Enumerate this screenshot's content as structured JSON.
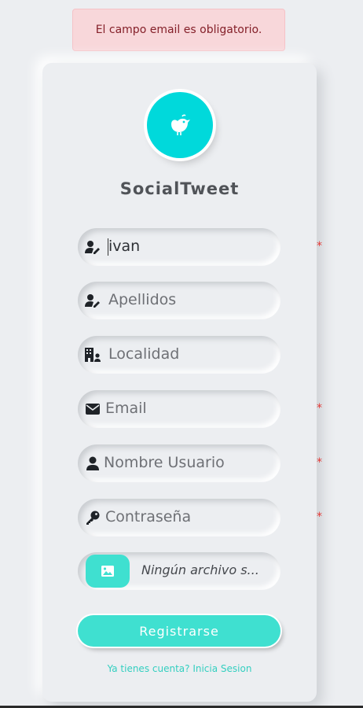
{
  "alert": {
    "message": "El campo email es obligatorio."
  },
  "brand": {
    "name": "SocialTweet",
    "accent": "#00d9db"
  },
  "form": {
    "fields": [
      {
        "name": "nombre",
        "icon": "user-edit-icon",
        "value": "ivan",
        "placeholder": "",
        "required": true
      },
      {
        "name": "apellidos",
        "icon": "user-edit-icon",
        "value": "",
        "placeholder": "Apellidos",
        "required": false
      },
      {
        "name": "localidad",
        "icon": "building-user-icon",
        "value": "",
        "placeholder": "Localidad",
        "required": false
      },
      {
        "name": "email",
        "icon": "envelope-icon",
        "value": "",
        "placeholder": "Email",
        "required": true
      },
      {
        "name": "usuario",
        "icon": "user-icon",
        "value": "",
        "placeholder": "Nombre Usuario",
        "required": true
      },
      {
        "name": "password",
        "icon": "key-icon",
        "value": "",
        "placeholder": "Contraseña",
        "required": true
      }
    ],
    "required_mark": "*",
    "file": {
      "icon": "image-icon",
      "status": "Ningún archivo s..."
    },
    "submit_label": "Registrarse",
    "login_link": "Ya tienes cuenta? Inicia Sesion",
    "button_color": "#3fe0d0"
  }
}
